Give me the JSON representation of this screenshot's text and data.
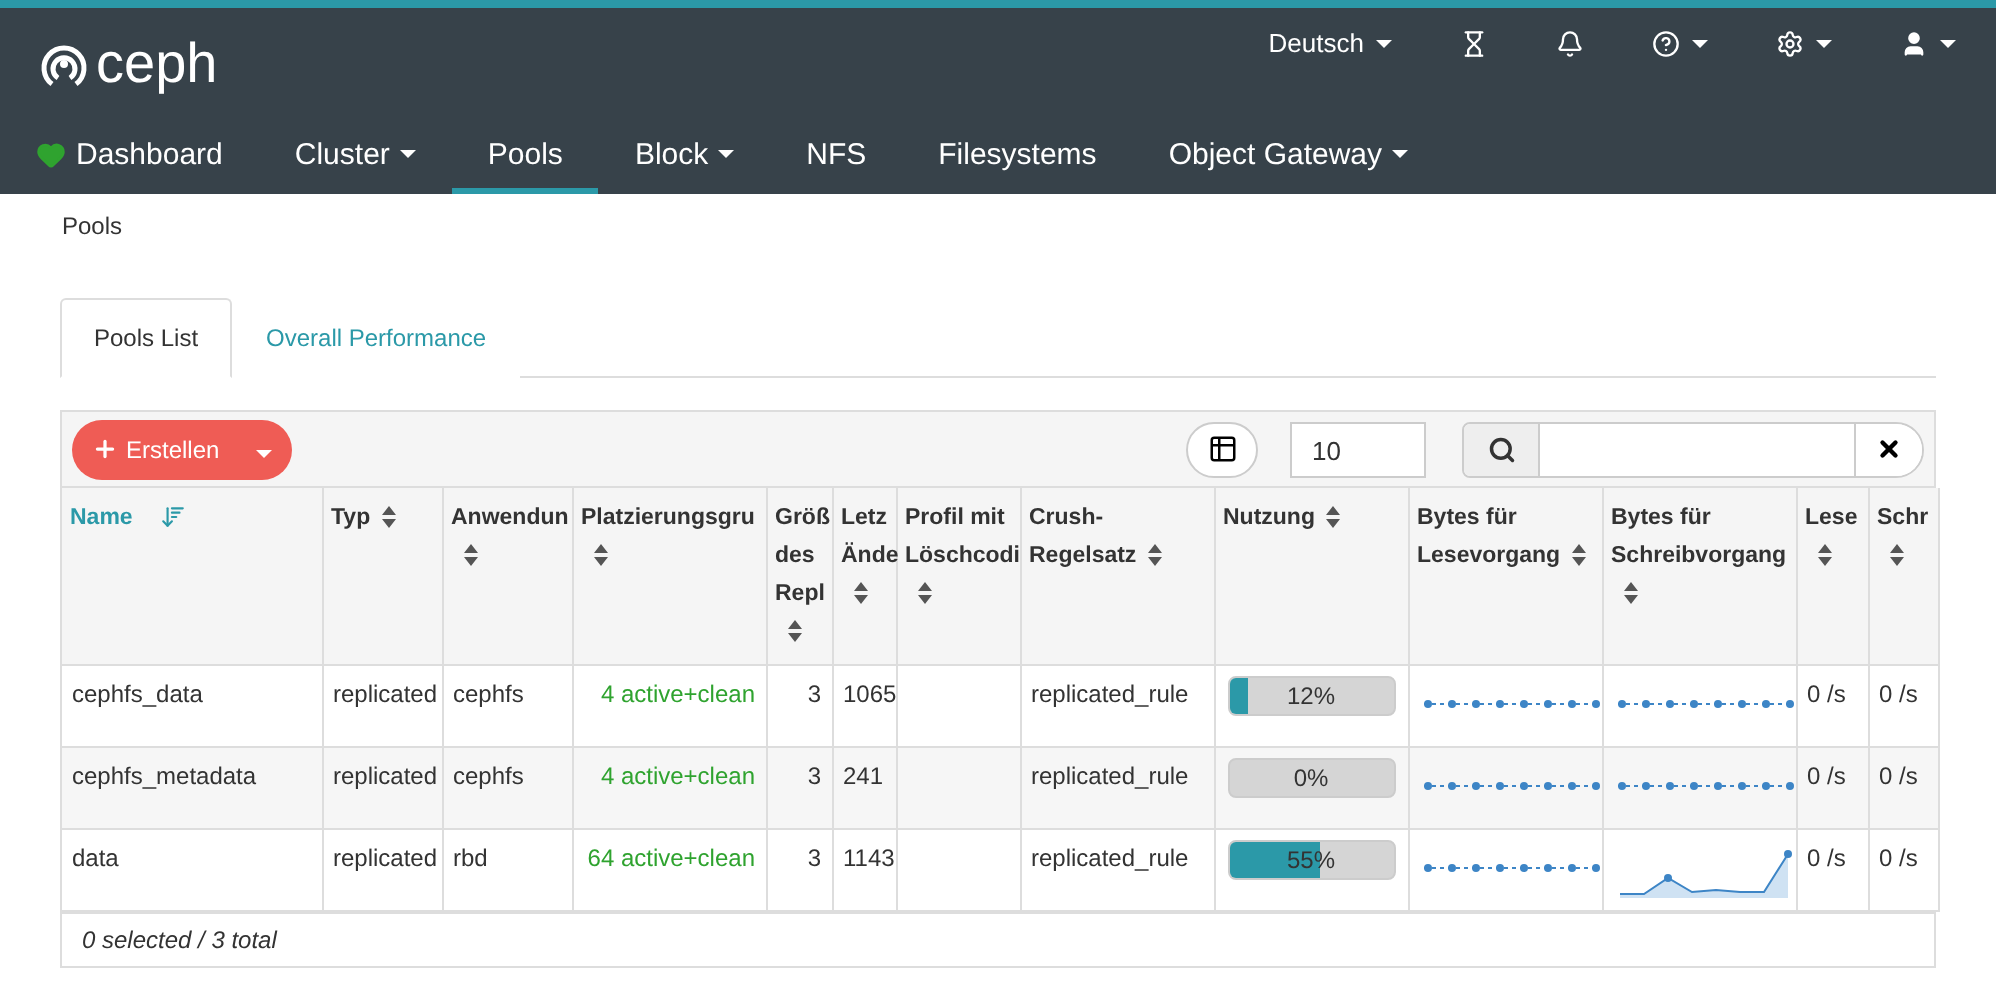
{
  "header": {
    "brand": "ceph",
    "language": "Deutsch"
  },
  "nav": [
    {
      "label": "Dashboard",
      "selected": false,
      "dropdown": false,
      "kind": "health"
    },
    {
      "label": "Cluster",
      "selected": false,
      "dropdown": true,
      "kind": "plain"
    },
    {
      "label": "Pools",
      "selected": true,
      "dropdown": false,
      "kind": "plain"
    },
    {
      "label": "Block",
      "selected": false,
      "dropdown": true,
      "kind": "plain"
    },
    {
      "label": "NFS",
      "selected": false,
      "dropdown": false,
      "kind": "plain"
    },
    {
      "label": "Filesystems",
      "selected": false,
      "dropdown": false,
      "kind": "plain"
    },
    {
      "label": "Object Gateway",
      "selected": false,
      "dropdown": true,
      "kind": "plain"
    }
  ],
  "breadcrumb": "Pools",
  "tabs": [
    {
      "label": "Pools List",
      "selected": true
    },
    {
      "label": "Overall Performance",
      "selected": false
    }
  ],
  "toolbar": {
    "create_button": "Erstellen",
    "page_size": "10"
  },
  "table": {
    "columns": [
      {
        "label": "Name",
        "sorted": true
      },
      {
        "label": "Typ",
        "sorted": false
      },
      {
        "label": "Anwendun",
        "sorted": false
      },
      {
        "label": "Platzierungsgru",
        "sorted": false
      },
      {
        "label": "Größ des Repl",
        "sorted": false
      },
      {
        "label": "Letz Ände",
        "sorted": false
      },
      {
        "label": "Profil mit Löschcodi",
        "sorted": false
      },
      {
        "label": "Crush- Regelsatz",
        "sorted": false
      },
      {
        "label": "Nutzung",
        "sorted": false
      },
      {
        "label": "Bytes für Lesevorgang",
        "sorted": false
      },
      {
        "label": "Bytes für Schreibvorgang",
        "sorted": false
      },
      {
        "label": "Lese",
        "sorted": false
      },
      {
        "label": "Schr",
        "sorted": false
      }
    ],
    "rows": [
      {
        "name": "cephfs_data",
        "type": "replicated",
        "application": "cephfs",
        "pg_status": "4 active+clean",
        "size": "3",
        "last_change": "1065",
        "crush_rule": "replicated_rule",
        "usage": {
          "level": 0.12,
          "text": "12%"
        },
        "write_sparkline": {
          "kind": "flat"
        },
        "read_ops": "0 /s",
        "write_ops": "0 /s"
      },
      {
        "name": "cephfs_metadata",
        "type": "replicated",
        "application": "cephfs",
        "pg_status": "4 active+clean",
        "size": "3",
        "last_change": "241",
        "crush_rule": "replicated_rule",
        "usage": {
          "level": 0,
          "text": "0%"
        },
        "write_sparkline": {
          "kind": "flat"
        },
        "read_ops": "0 /s",
        "write_ops": "0 /s"
      },
      {
        "name": "data",
        "type": "replicated",
        "application": "rbd",
        "pg_status": "64 active+clean",
        "size": "3",
        "last_change": "1143",
        "crush_rule": "replicated_rule",
        "usage": {
          "level": 0.55,
          "text": "55%"
        },
        "write_sparkline": {
          "kind": "active"
        },
        "read_ops": "0 /s",
        "write_ops": "0 /s"
      }
    ],
    "footer": "0 selected / 3 total"
  }
}
